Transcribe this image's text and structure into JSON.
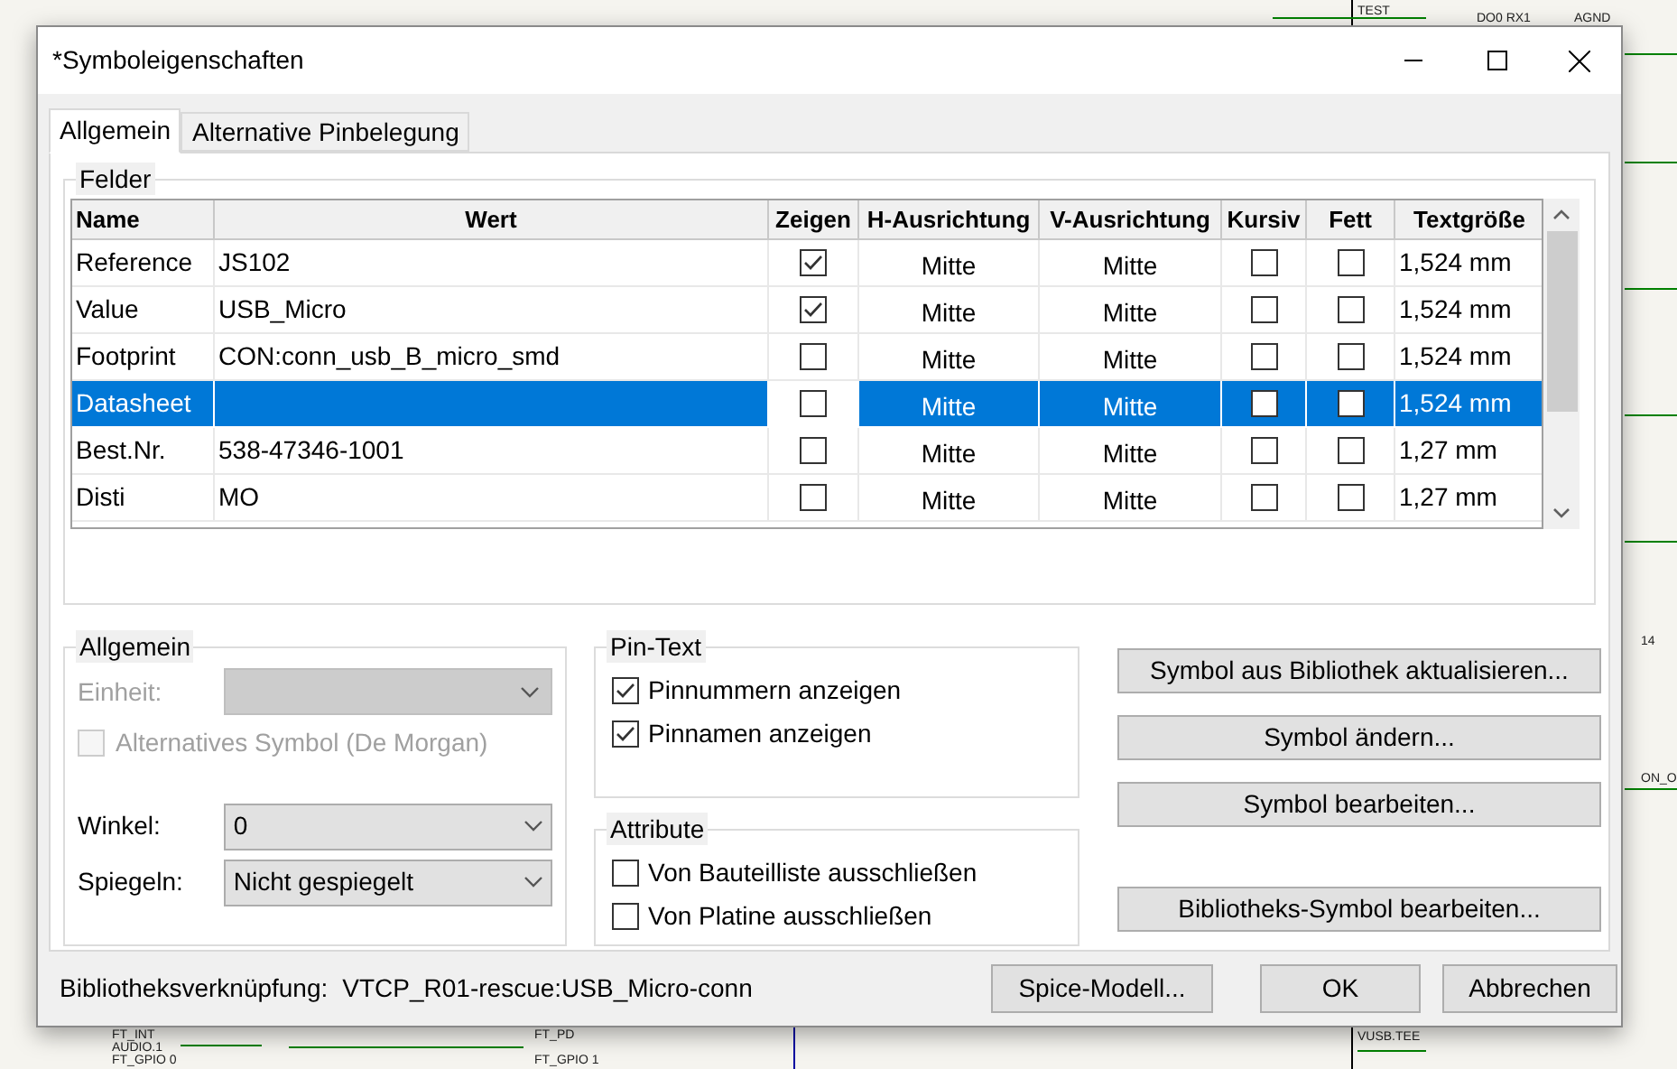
{
  "schematic": {
    "labels": [
      {
        "text": "TEST"
      },
      {
        "text": "DO0 RX1"
      },
      {
        "text": "AGND"
      },
      {
        "text": "FT_INT"
      },
      {
        "text": "AUDIO.1"
      },
      {
        "text": "FT_GPIO 0"
      },
      {
        "text": "FT_PD"
      },
      {
        "text": "FT_GPIO 1"
      },
      {
        "text": "VUSB.TEE"
      },
      {
        "text": "ON_O"
      },
      {
        "text": "14"
      }
    ]
  },
  "window": {
    "title": "*Symboleigenschaften"
  },
  "tabs": [
    {
      "label": "Allgemein",
      "selected": true
    },
    {
      "label": "Alternative Pinbelegung",
      "selected": false
    }
  ],
  "fields": {
    "title": "Felder",
    "columns": [
      "Name",
      "Wert",
      "Zeigen",
      "H-Ausrichtung",
      "V-Ausrichtung",
      "Kursiv",
      "Fett",
      "Textgröße"
    ],
    "rows": [
      {
        "name": "Reference",
        "value": "JS102",
        "show": true,
        "h_align": "Mitte",
        "v_align": "Mitte",
        "italic": false,
        "bold": false,
        "size": "1,524 mm",
        "selected": false
      },
      {
        "name": "Value",
        "value": "USB_Micro",
        "show": true,
        "h_align": "Mitte",
        "v_align": "Mitte",
        "italic": false,
        "bold": false,
        "size": "1,524 mm",
        "selected": false
      },
      {
        "name": "Footprint",
        "value": "CON:conn_usb_B_micro_smd",
        "show": false,
        "h_align": "Mitte",
        "v_align": "Mitte",
        "italic": false,
        "bold": false,
        "size": "1,524 mm",
        "selected": false
      },
      {
        "name": "Datasheet",
        "value": "",
        "show": false,
        "h_align": "Mitte",
        "v_align": "Mitte",
        "italic": false,
        "bold": false,
        "size": "1,524 mm",
        "selected": true
      },
      {
        "name": "Best.Nr.",
        "value": "538-47346-1001",
        "show": false,
        "h_align": "Mitte",
        "v_align": "Mitte",
        "italic": false,
        "bold": false,
        "size": "1,27 mm",
        "selected": false
      },
      {
        "name": "Disti",
        "value": "MO",
        "show": false,
        "h_align": "Mitte",
        "v_align": "Mitte",
        "italic": false,
        "bold": false,
        "size": "1,27 mm",
        "selected": false
      }
    ]
  },
  "general": {
    "title": "Allgemein",
    "unit_label": "Einheit:",
    "unit_disabled": true,
    "alt_symbol": {
      "label": "Alternatives Symbol (De Morgan)",
      "checked": false,
      "disabled": true
    },
    "angle_label": "Winkel:",
    "angle": "0",
    "mirror_label": "Spiegeln:",
    "mirror": "Nicht gespiegelt"
  },
  "pin_text": {
    "title": "Pin-Text",
    "options": [
      {
        "label": "Pinnummern anzeigen",
        "checked": true
      },
      {
        "label": "Pinnamen anzeigen",
        "checked": true
      }
    ]
  },
  "attributes": {
    "title": "Attribute",
    "options": [
      {
        "label": "Von Bauteilliste ausschließen",
        "checked": false
      },
      {
        "label": "Von Platine ausschließen",
        "checked": false
      }
    ]
  },
  "side_buttons": [
    "Symbol aus Bibliothek aktualisieren...",
    "Symbol ändern...",
    "Symbol bearbeiten...",
    "Bibliotheks-Symbol bearbeiten..."
  ],
  "footer": {
    "link_label": "Bibliotheksverknüpfung:",
    "link_value": "VTCP_R01-rescue:USB_Micro-conn",
    "buttons": [
      "Spice-Modell...",
      "OK",
      "Abbrechen"
    ]
  }
}
